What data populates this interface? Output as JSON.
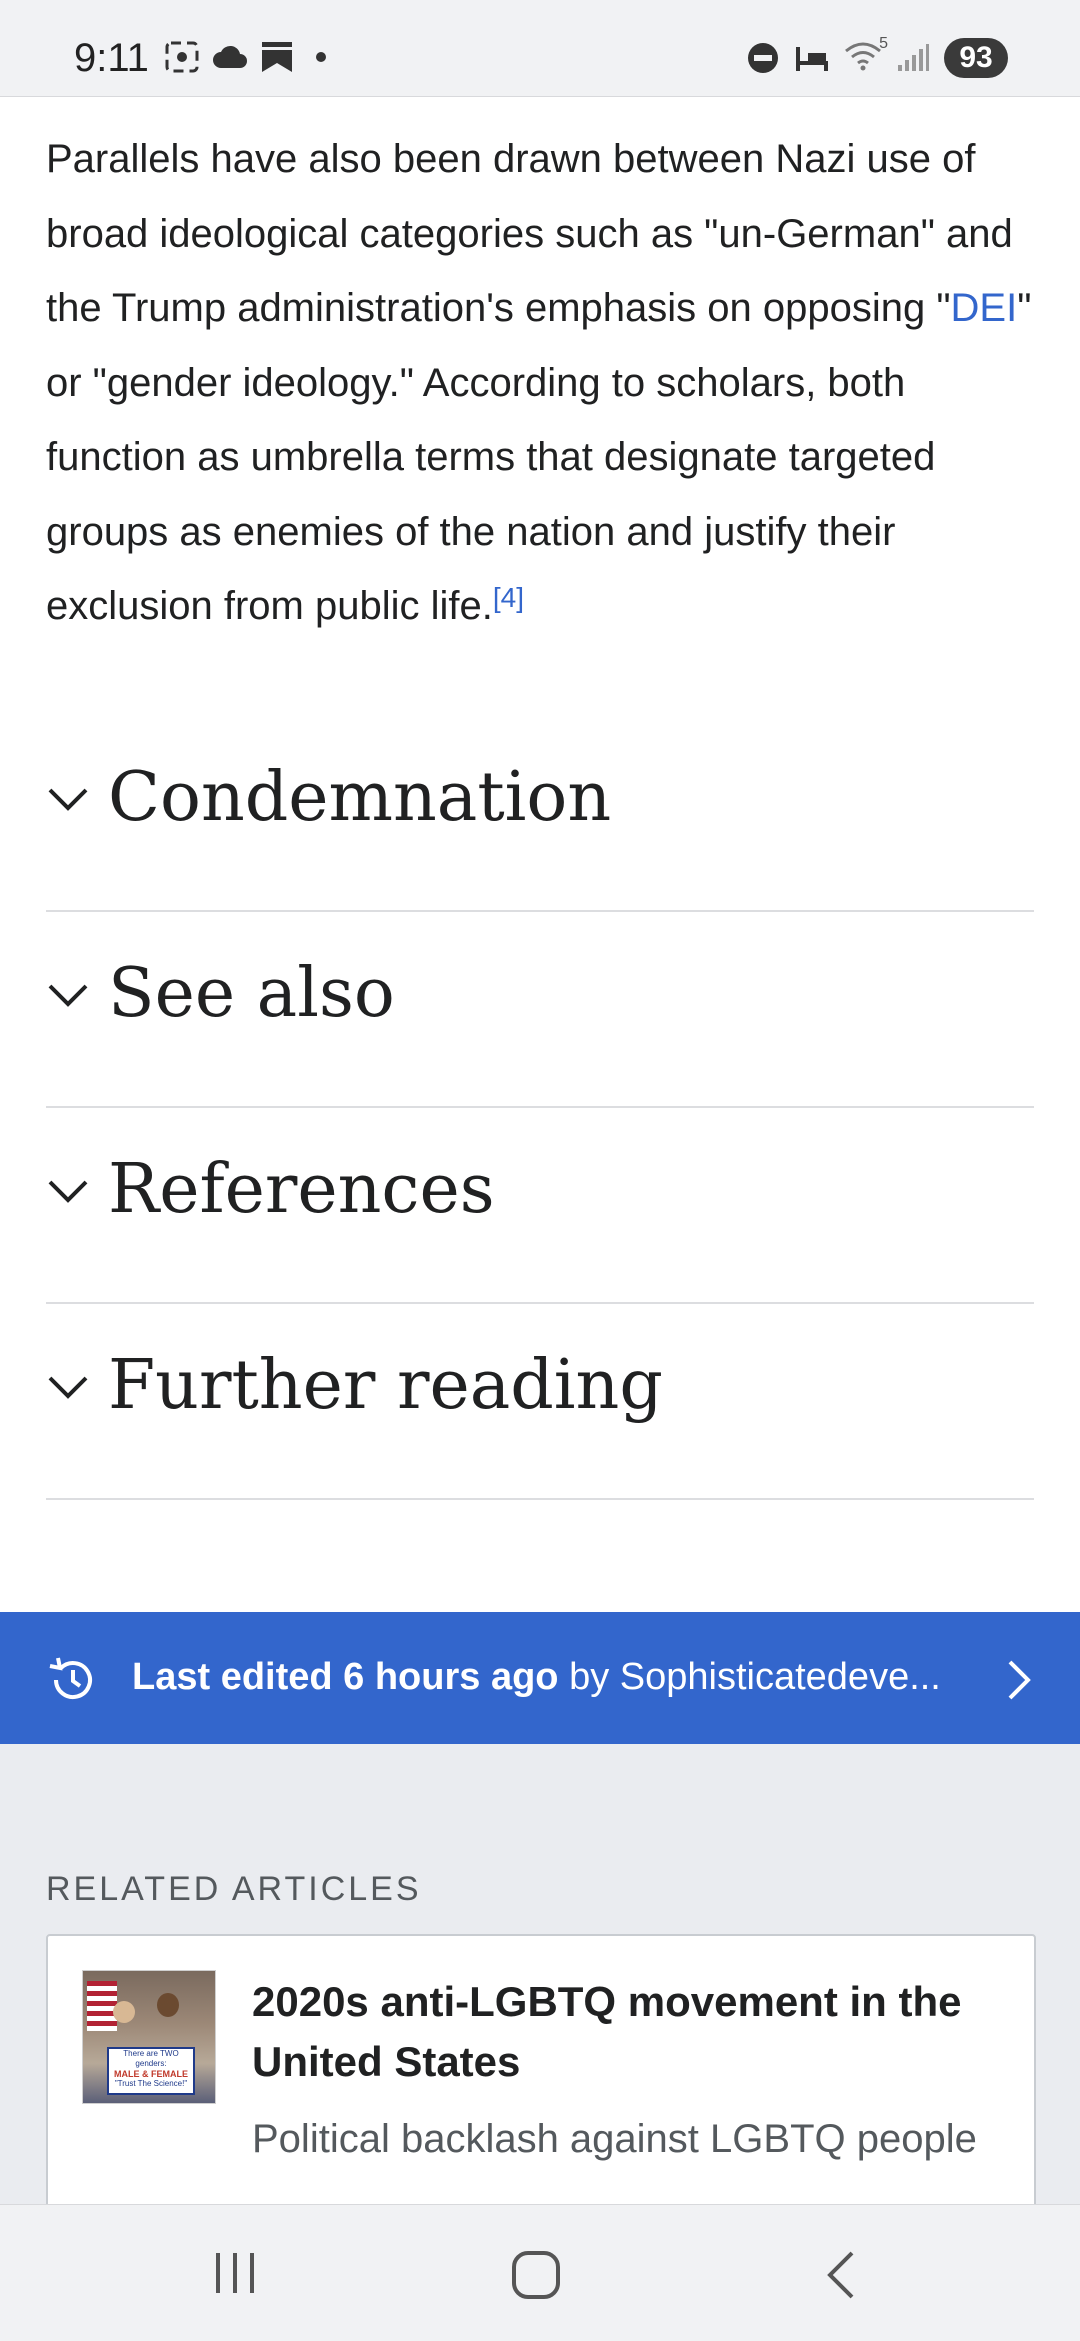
{
  "status_bar": {
    "time": "9:11",
    "left_icons": [
      "screenshot-icon",
      "cloud-icon",
      "bookmark-icon",
      "dot-icon"
    ],
    "right_icons": [
      "do-not-disturb-icon",
      "sleep-icon",
      "wifi-icon",
      "signal-icon"
    ],
    "wifi_label": "5",
    "battery": "93"
  },
  "article": {
    "para_before_link": "Parallels have also been drawn between Nazi use of broad ideological categories such as \"un-German\" and the Trump administration's emphasis on opposing \"",
    "link_text": "DEI",
    "para_after_link": "\" or \"gender ideology.\" According to scholars, both function as umbrella terms that designate targeted groups as enemies of the nation and justify their exclusion from public life.",
    "citation": "[4]"
  },
  "sections": [
    {
      "label": "Condemnation"
    },
    {
      "label": "See also"
    },
    {
      "label": "References"
    },
    {
      "label": "Further reading"
    }
  ],
  "last_edited": {
    "bold": "Last edited 6 hours ago",
    "rest": " by Sophisticatedeve..."
  },
  "related": {
    "heading": "RELATED ARTICLES",
    "card": {
      "title": "2020s anti-LGBTQ movement in the United States",
      "description": "Political backlash against LGBTQ people",
      "thumb_text_1": "There are TWO genders:",
      "thumb_text_2": "MALE & FEMALE",
      "thumb_text_3": "\"Trust The Science!\""
    }
  },
  "colors": {
    "link": "#3366cc",
    "banner": "#3366cc",
    "related_bg": "#eaecf0"
  }
}
